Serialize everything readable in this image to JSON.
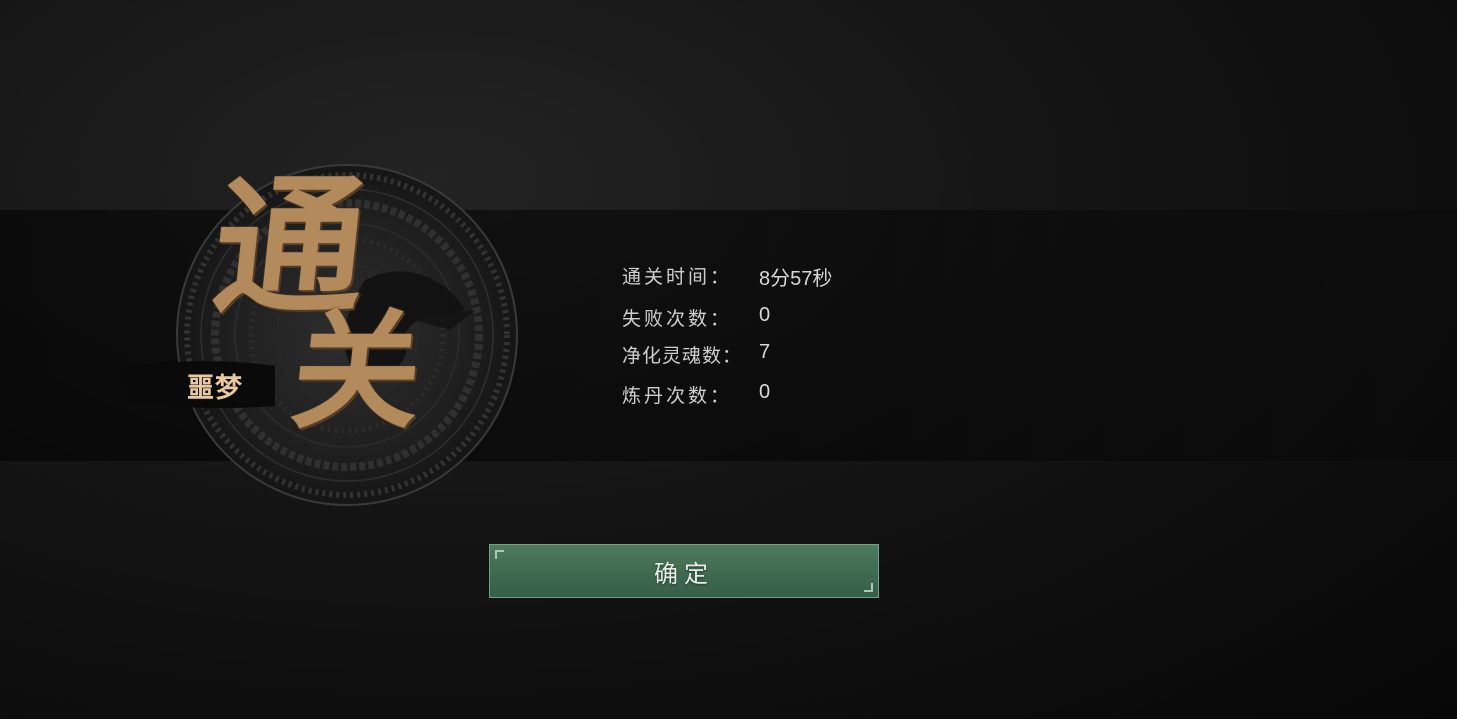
{
  "result": {
    "title_char_1": "通",
    "title_char_2": "关",
    "difficulty": "噩梦"
  },
  "stats": [
    {
      "label": "通关时间：",
      "value": "8分57秒"
    },
    {
      "label": "失败次数：",
      "value": "0"
    },
    {
      "label": "净化灵魂数：",
      "value": "7"
    },
    {
      "label": "炼丹次数：",
      "value": "0"
    }
  ],
  "confirm_button": {
    "label": "确定"
  },
  "colors": {
    "title_gold": "#b38a5c",
    "difficulty_text": "#e9c9a2",
    "button_green": "#4a765c",
    "background": "#111111"
  }
}
